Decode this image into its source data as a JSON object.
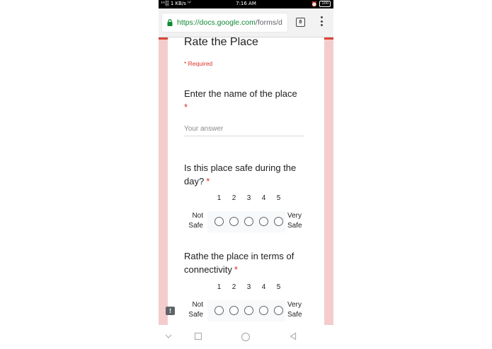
{
  "status_bar": {
    "network": "¹ᴳ⸽⸽⸽ 1 KB/s ʰᶠ",
    "time": "7:16 AM",
    "battery": "100"
  },
  "browser": {
    "url_host": "https://docs.google.com",
    "url_path": "/forms/d",
    "tab_count": "8"
  },
  "form": {
    "title": "Rate the Place",
    "required_note": "* Required",
    "questions": [
      {
        "text": "Enter the name of the place",
        "star": "*",
        "placeholder": "Your answer"
      },
      {
        "text": "Is this place safe during the day?",
        "star": "*",
        "scale": [
          "1",
          "2",
          "3",
          "4",
          "5"
        ],
        "low_label_1": "Not",
        "low_label_2": "Safe",
        "high_label_1": "Very",
        "high_label_2": "Safe"
      },
      {
        "text": "Rathe the place in terms of connectivity",
        "star": "*",
        "scale": [
          "1",
          "2",
          "3",
          "4",
          "5"
        ],
        "low_label_1": "Not",
        "low_label_2": "Safe",
        "high_label_1": "Very",
        "high_label_2": "Safe"
      }
    ]
  },
  "feedback_icon_glyph": "!",
  "colors": {
    "accent": "#db4437",
    "background": "#f4cccc",
    "secure_url": "#0f8a34",
    "required": "#d93025"
  },
  "icons": [
    "lock-icon",
    "tab-switcher-icon",
    "overflow-menu-icon",
    "feedback-icon",
    "nav-down-icon",
    "nav-recents-icon",
    "nav-home-icon",
    "nav-back-icon"
  ]
}
